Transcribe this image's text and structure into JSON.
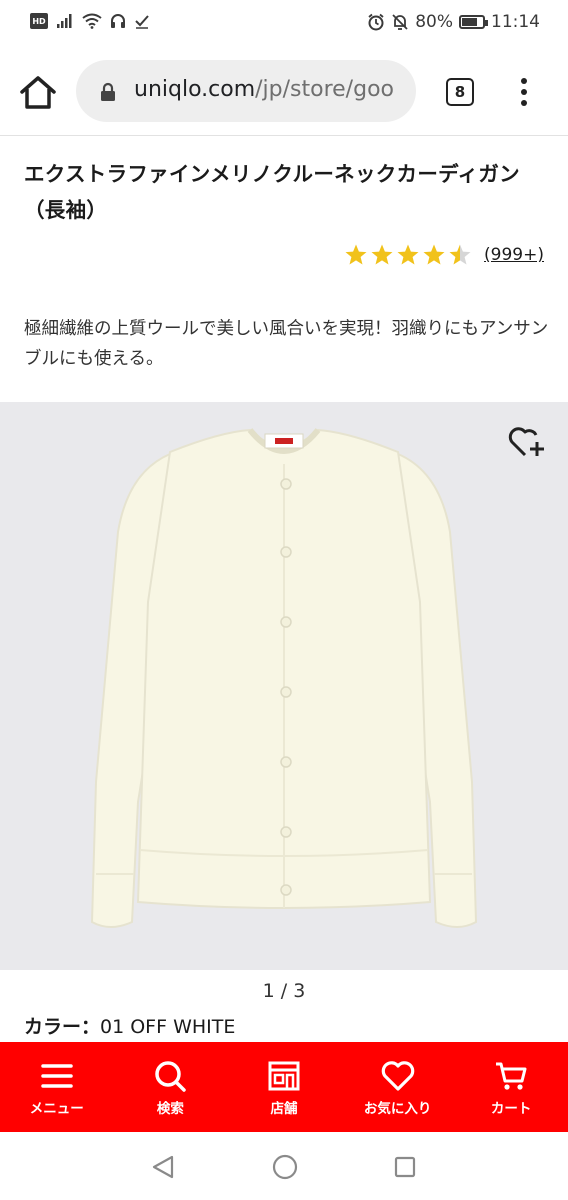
{
  "status_bar": {
    "hd_badge": "HD",
    "battery_percent": "80%",
    "battery_level": 0.8,
    "time": "11:14",
    "icons": [
      "signal-icon",
      "wifi-icon",
      "headset-icon",
      "check-icon",
      "alarm-icon",
      "mute-icon",
      "battery-icon"
    ]
  },
  "browser": {
    "url_domain": "uniqlo.com",
    "url_path": "/jp/store/goo",
    "tab_count": "8"
  },
  "product": {
    "title": "エクストラファインメリノクルーネックカーディガン（長袖）",
    "rating": 4.5,
    "review_count": "(999+)",
    "description": "極細繊維の上質ウールで美しい風合いを実現！羽織りにもアンサンブルにも使える。",
    "image_pager": "1 / 3",
    "color_label": "カラー：",
    "color_value": "01 OFF WHITE",
    "image_color": "#f8f6e4"
  },
  "bottom_nav": {
    "items": [
      {
        "label": "メニュー",
        "icon": "menu-icon"
      },
      {
        "label": "検索",
        "icon": "search-icon"
      },
      {
        "label": "店舗",
        "icon": "store-icon"
      },
      {
        "label": "お気に入り",
        "icon": "heart-icon"
      },
      {
        "label": "カート",
        "icon": "cart-icon"
      }
    ],
    "background": "#ff0000"
  },
  "colors": {
    "star": "#f1c21b",
    "brand_red": "#ff0000"
  }
}
